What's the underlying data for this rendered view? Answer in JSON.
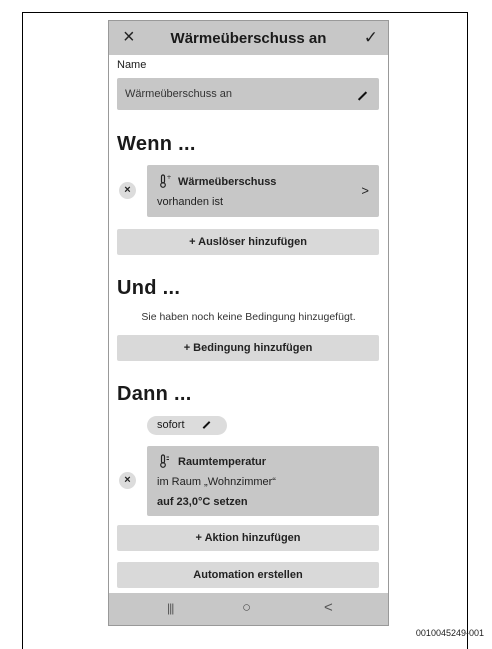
{
  "figure_id": "0010045249-001",
  "topbar": {
    "title": "Wärmeüberschuss an",
    "close_icon": "×",
    "confirm_icon": "✓"
  },
  "name_section": {
    "label": "Name",
    "value": "Wärmeüberschuss an"
  },
  "when_section": {
    "heading": "Wenn ...",
    "trigger": {
      "title": "Wärmeüberschuss",
      "subtitle": "vorhanden ist",
      "chevron": ">"
    },
    "add_button": "+ Auslöser hinzufügen"
  },
  "and_section": {
    "heading": "Und ...",
    "empty_text": "Sie haben noch keine Bedingung hinzugefügt.",
    "add_button": "+ Bedingung hinzufügen"
  },
  "then_section": {
    "heading": "Dann ...",
    "timing_chip": "sofort",
    "action": {
      "title": "Raumtemperatur",
      "line2": "im Raum „Wohnzimmer“",
      "line3": "auf 23,0°C setzen"
    },
    "add_button": "+ Aktion hinzufügen"
  },
  "create_button": "Automation erstellen",
  "navbar": {
    "recents": "|||",
    "home": "○",
    "back": "<"
  },
  "remove_icon": "×"
}
